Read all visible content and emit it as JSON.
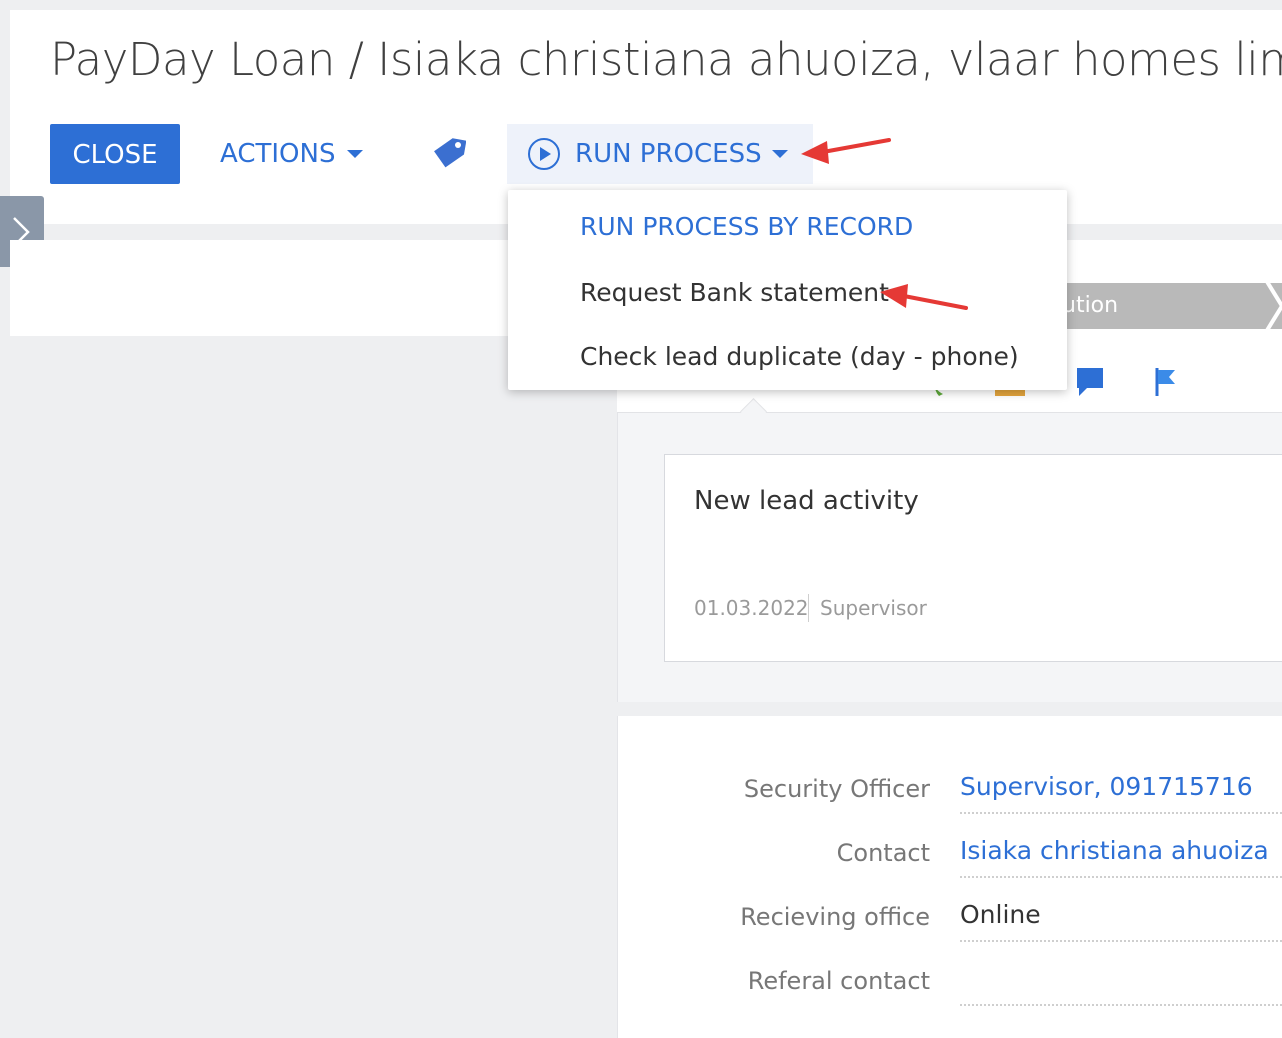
{
  "header": {
    "title": "PayDay Loan / Isiaka christiana ahuoiza, vlaar homes limit",
    "close_label": "CLOSE",
    "actions_label": "ACTIONS",
    "run_process_label": "RUN PROCESS"
  },
  "run_process_menu": {
    "heading": "RUN PROCESS BY RECORD",
    "items": [
      {
        "label": "Request Bank statement"
      },
      {
        "label": "Check lead duplicate (day - phone)"
      }
    ]
  },
  "stage_bar": {
    "partial_label": "ution"
  },
  "activity": {
    "title": "New lead activity",
    "date": "01.03.2022",
    "owner": "Supervisor"
  },
  "details": {
    "fields": [
      {
        "label": "Security Officer",
        "value": "Supervisor, 091715716"
      },
      {
        "label": "Contact",
        "value": "Isiaka christiana ahuoiza"
      },
      {
        "label": "Recieving office",
        "value": "Online"
      },
      {
        "label": "Referal contact",
        "value": ""
      }
    ]
  },
  "colors": {
    "accent": "#2d6fd5",
    "annotation_arrow": "#e53935"
  },
  "icons": [
    "tag-icon",
    "play-circle-icon",
    "chevron-right-icon",
    "chat-icon",
    "flag-icon"
  ]
}
